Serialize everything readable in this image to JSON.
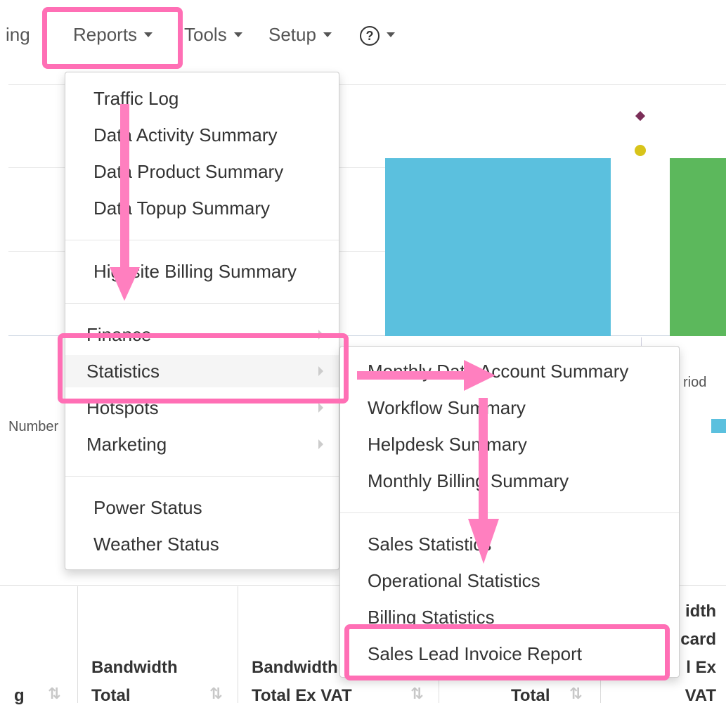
{
  "nav": {
    "partial_item": "ing",
    "reports": "Reports",
    "tools": "Tools",
    "setup": "Setup",
    "help_icon": "?"
  },
  "reports_menu": {
    "items_group1": [
      "Traffic Log",
      "Data Activity Summary",
      "Data Product Summary",
      "Data Topup Summary"
    ],
    "items_group2": [
      "Highsite Billing Summary"
    ],
    "items_group3": [
      "Finance",
      "Statistics",
      "Hotspots",
      "Marketing"
    ],
    "items_group4": [
      "Power Status",
      "Weather Status"
    ]
  },
  "statistics_menu": {
    "items_group1": [
      "Monthly Data Account Summary",
      "Workflow Summary",
      "Helpdesk Summary",
      "Monthly Billing Summary"
    ],
    "items_group2": [
      "Sales Statistics",
      "Operational Statistics",
      "Billing Statistics",
      "Sales Lead Invoice Report"
    ]
  },
  "background": {
    "chart_label_left": "Number",
    "chart_label_right": "riod"
  },
  "table": {
    "headers": [
      {
        "line1": "",
        "line2": "g"
      },
      {
        "line1": "Bandwidth",
        "line2": "Total"
      },
      {
        "line1": "Bandwidth",
        "line2": "Total Ex VAT"
      },
      {
        "line1": "",
        "line2": "Total"
      },
      {
        "line1": "idth",
        "line2": "card",
        "line3": "l Ex",
        "line4": "VAT"
      }
    ]
  },
  "colors": {
    "highlight": "#ff6fb5",
    "bar_blue": "#5bc0de",
    "bar_green": "#5cb85c",
    "arrow": "#ff7fbf"
  }
}
